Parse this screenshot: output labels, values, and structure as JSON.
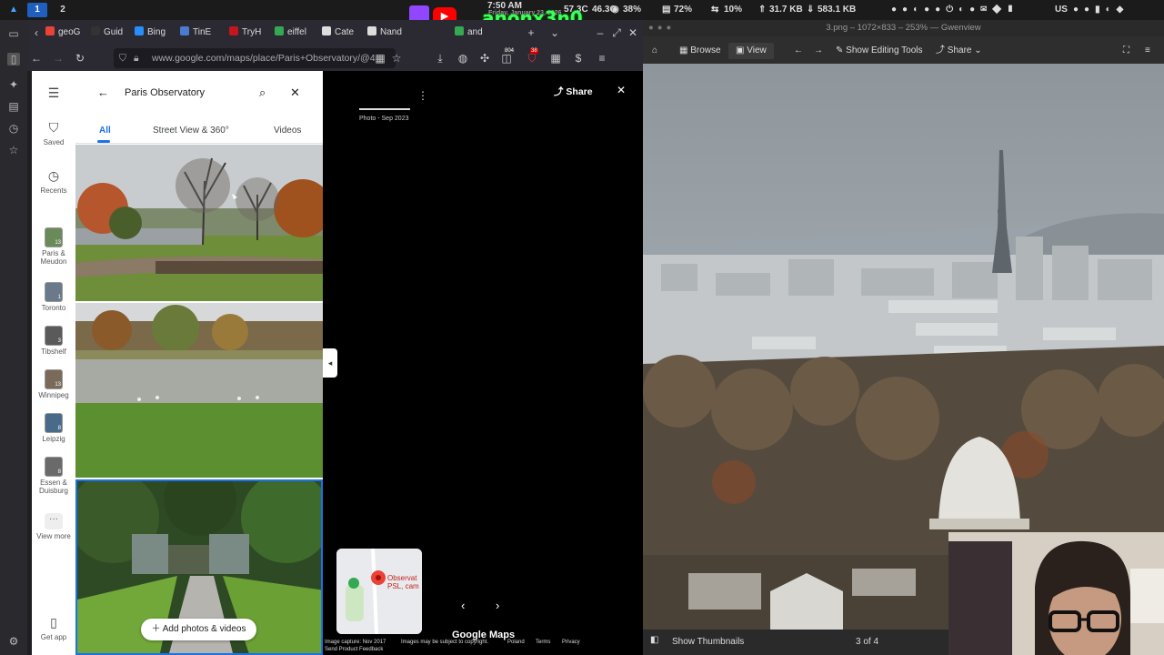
{
  "system_bar": {
    "workspaces": [
      "1",
      "2"
    ],
    "clock_time": "7:50 AM",
    "clock_date": "Friday, January 23, 2026",
    "temp1": "57.3C",
    "temp2": "46.3C",
    "cpu": "38%",
    "mem": "72%",
    "swap": "10%",
    "net_up": "31.7 KB",
    "net_down": "583.1 KB",
    "keyboard_layout": "US",
    "stream_handle": "anonx3n0"
  },
  "browser": {
    "tabs": [
      {
        "label": "geoG",
        "color": "#ea4335"
      },
      {
        "label": "Guid",
        "color": "#333333"
      },
      {
        "label": "Bing",
        "color": "#258ffa"
      },
      {
        "label": "TinE",
        "color": "#4a7bd0"
      },
      {
        "label": "TryH",
        "color": "#c4161c"
      },
      {
        "label": "eiffel",
        "color": "#34a853"
      },
      {
        "label": "Cate",
        "color": "#dddddd"
      },
      {
        "label": "Nand",
        "color": "#dddddd"
      },
      {
        "label": "and",
        "color": "#34a853"
      }
    ],
    "url": "www.google.com/maps/place/Paris+Observatory/@4",
    "badges": {
      "ext1": "804",
      "ext2": "38"
    }
  },
  "maps": {
    "rail": {
      "saved": "Saved",
      "recents": "Recents",
      "places": [
        {
          "label": "Paris & Meudon",
          "count": "13"
        },
        {
          "label": "Toronto",
          "count": "1"
        },
        {
          "label": "Tibshelf",
          "count": "3"
        },
        {
          "label": "Winnipeg",
          "count": "13"
        },
        {
          "label": "Leipzig",
          "count": "8"
        },
        {
          "label": "Essen & Duisburg",
          "count": "8"
        }
      ],
      "view_more": "View more",
      "get_app": "Get app"
    },
    "search_value": "Paris Observatory",
    "filter_tabs": [
      "All",
      "Street View & 360°",
      "Videos"
    ],
    "add_photos": "Add photos & videos",
    "viewer": {
      "share": "Share",
      "photo_date": "Photo - Sep 2023",
      "minimap_label": "Observat PSL, cam",
      "google_maps": "Google Maps",
      "image_capture": "Image capture: Nov 2017",
      "copyright": "Images may be subject to copyright.",
      "country": "Poland",
      "terms": "Terms",
      "privacy": "Privacy",
      "feedback": "Send Product Feedback"
    }
  },
  "gwenview": {
    "title": "3.png – 1072×833 – 253% — Gwenview",
    "browse": "Browse",
    "view": "View",
    "editing": "Show Editing Tools",
    "share": "Share",
    "show_thumbnails": "Show Thumbnails",
    "counter": "3 of 4"
  }
}
